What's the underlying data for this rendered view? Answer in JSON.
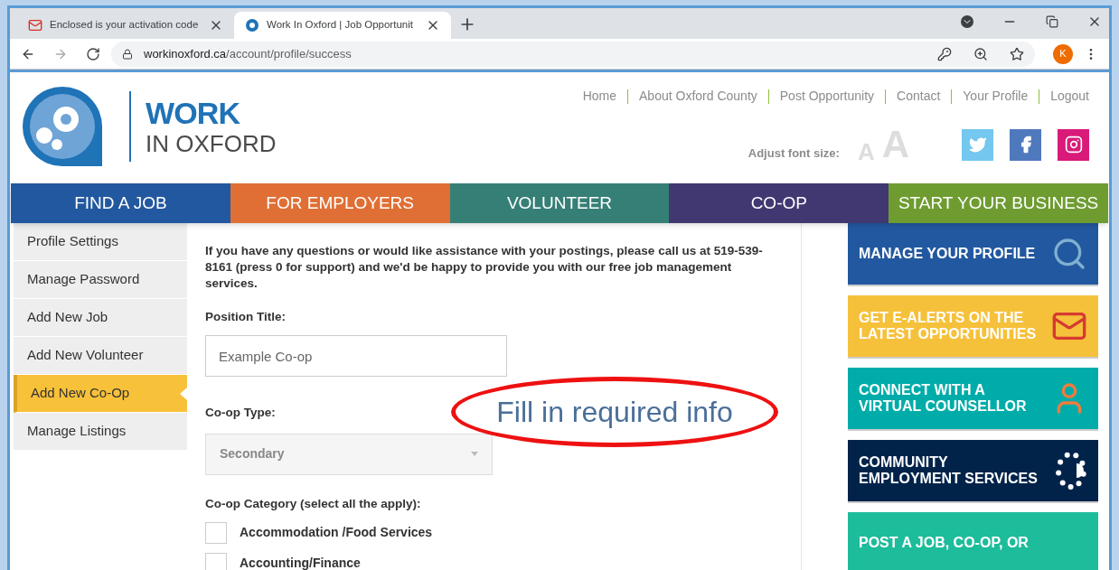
{
  "browser": {
    "tabs": [
      {
        "title": "Enclosed is your activation code",
        "selected": false
      },
      {
        "title": "Work In Oxford | Job Opportunit",
        "selected": true
      }
    ],
    "address": {
      "domain": "workinoxford.ca",
      "path": "/account/profile/success"
    },
    "profile_initial": "K"
  },
  "header": {
    "logo": {
      "line1": "WORK",
      "line2": "IN OXFORD"
    },
    "top_links": [
      "Home",
      "About Oxford County",
      "Post Opportunity",
      "Contact",
      "Your Profile",
      "Logout"
    ],
    "font_size": {
      "label": "Adjust font size:",
      "small": "A",
      "large": "A"
    },
    "social": [
      {
        "kind": "twitter",
        "color": "#74c7ee"
      },
      {
        "kind": "facebook",
        "color": "#4f79bd"
      },
      {
        "kind": "instagram",
        "color": "#d91a79"
      }
    ]
  },
  "nav": [
    {
      "label": "FIND A JOB",
      "color": "#22589f"
    },
    {
      "label": "FOR EMPLOYERS",
      "color": "#e06f35"
    },
    {
      "label": "VOLUNTEER",
      "color": "#367f76"
    },
    {
      "label": "CO-OP",
      "color": "#413872"
    },
    {
      "label": "START YOUR BUSINESS",
      "color": "#6e9c31"
    }
  ],
  "sidebar": [
    {
      "label": "Profile Settings",
      "selected": false
    },
    {
      "label": "Manage Password",
      "selected": false
    },
    {
      "label": "Add New Job",
      "selected": false
    },
    {
      "label": "Add New Volunteer",
      "selected": false
    },
    {
      "label": "Add New Co-Op",
      "selected": true
    },
    {
      "label": "Manage Listings",
      "selected": false
    }
  ],
  "form": {
    "intro": "If you have any questions or would like assistance with your postings, please call us at 519-539-8161 (press 0 for support) and we'd be happy to provide you with our free job management services.",
    "position_title": {
      "label": "Position Title:",
      "placeholder": "Example Co-op"
    },
    "coop_type": {
      "label": "Co-op Type:",
      "value": "Secondary",
      "disabled": true
    },
    "category": {
      "label": "Co-op Category (select all the apply):",
      "options": [
        {
          "label": "Accommodation /Food Services",
          "checked": false
        },
        {
          "label": "Accounting/Finance",
          "checked": false
        }
      ]
    }
  },
  "annotation": "Fill in required info",
  "promos": [
    {
      "text": "MANAGE YOUR PROFILE",
      "kind": "search",
      "color": "#22589f"
    },
    {
      "text": "GET E-ALERTS ON THE LATEST OPPORTUNITIES",
      "kind": "mail",
      "color": "#f6c13a"
    },
    {
      "text": "CONNECT WITH A VIRTUAL COUNSELLOR",
      "kind": "person",
      "color": "#00aca9"
    },
    {
      "text": "COMMUNITY EMPLOYMENT SERVICES",
      "kind": "dots",
      "color": "#01234a"
    },
    {
      "text": "POST A JOB, CO-OP, OR",
      "kind": "none",
      "color": "#1dbc9b"
    }
  ]
}
